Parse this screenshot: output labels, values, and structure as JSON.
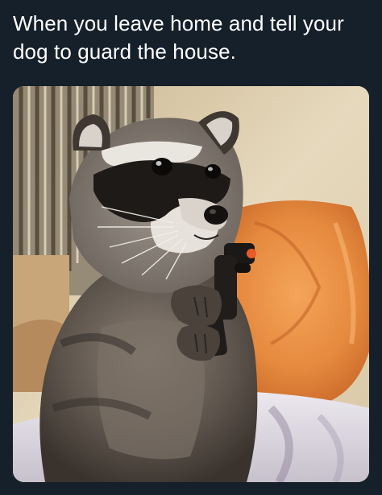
{
  "tweet": {
    "text": "When you leave home and tell your dog to guard the house."
  },
  "media": {
    "subject": "raccoon-holding-toy-gun-photo"
  }
}
